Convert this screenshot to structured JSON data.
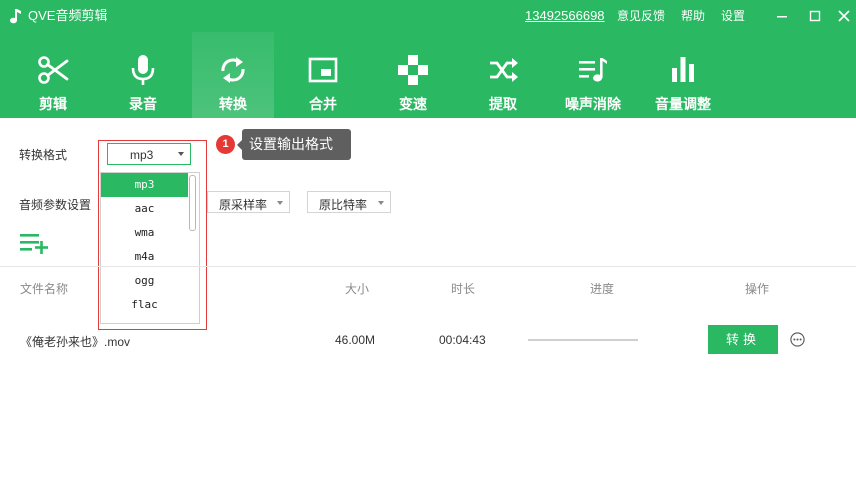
{
  "window": {
    "title": "QVE音频剪辑",
    "phone": "13492566698",
    "links": {
      "feedback": "意见反馈",
      "help": "帮助",
      "settings": "设置"
    }
  },
  "toolbar": {
    "items": [
      {
        "label": "剪辑",
        "icon": "scissors-icon"
      },
      {
        "label": "录音",
        "icon": "microphone-icon"
      },
      {
        "label": "转换",
        "icon": "convert-icon",
        "active": true
      },
      {
        "label": "合并",
        "icon": "merge-icon"
      },
      {
        "label": "变速",
        "icon": "speed-icon"
      },
      {
        "label": "提取",
        "icon": "extract-icon"
      },
      {
        "label": "噪声消除",
        "icon": "noise-removal-icon"
      },
      {
        "label": "音量调整",
        "icon": "volume-bars-icon"
      }
    ]
  },
  "convert": {
    "format_label": "转换格式",
    "format_value": "mp3",
    "format_options": [
      "mp3",
      "aac",
      "wma",
      "m4a",
      "ogg",
      "flac"
    ],
    "params_label": "音频参数设置",
    "sample_rate": "原采样率",
    "bit_rate": "原比特率"
  },
  "tip": {
    "number": "1",
    "text": "设置输出格式"
  },
  "table": {
    "headers": {
      "name": "文件名称",
      "size": "大小",
      "duration": "时长",
      "progress": "进度",
      "action": "操作"
    },
    "rows": [
      {
        "name": "《俺老孙来也》.mov",
        "size": "46.00M",
        "duration": "00:04:43",
        "progress": 0,
        "action_label": "转换"
      }
    ]
  },
  "colors": {
    "accent": "#2bb863",
    "highlight_border": "#e23b3b",
    "badge": "#e53935",
    "tooltip": "#5f5f5f"
  }
}
